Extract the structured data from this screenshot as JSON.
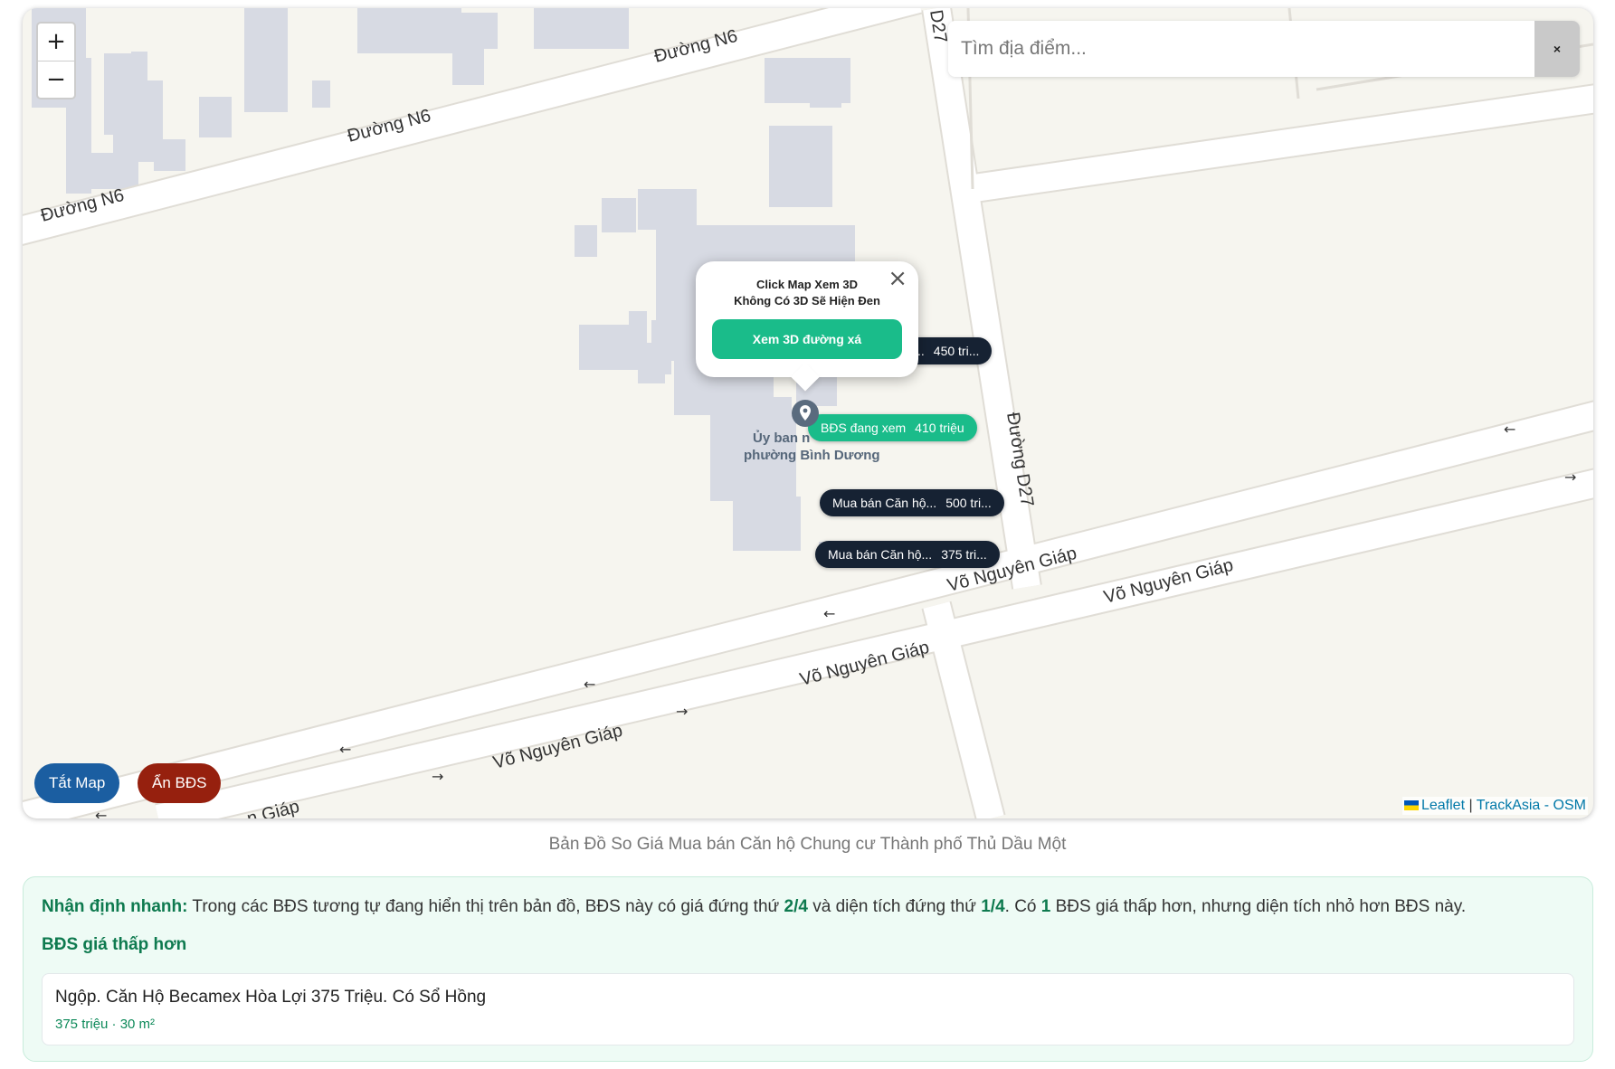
{
  "map": {
    "zoom_in": "+",
    "zoom_out": "−",
    "search": {
      "placeholder": "Tìm địa điểm...",
      "clear": "×"
    },
    "road_labels": {
      "n6_a": "Đường N6",
      "n6_b": "Đường N6",
      "n6_c": "Đường N6",
      "d27_top": "D27",
      "d27_mid": "Đường D27",
      "vng_1": "Võ Nguyên Giáp",
      "vng_2": "Võ Nguyên Giáp",
      "vng_3": "Võ Nguyên Giáp",
      "vng_4": "Võ Nguyên Giáp",
      "vng_5": "n Giáp"
    },
    "poi": {
      "line1": "Ủy ban n",
      "line2": "phường Bình Dương"
    },
    "popup": {
      "line1": "Click Map Xem 3D",
      "line2": "Không Có 3D Sẽ Hiện Đen",
      "button": "Xem 3D đường xá",
      "close": "×"
    },
    "markers": [
      {
        "title": "..",
        "price": "450 tri..."
      },
      {
        "title": "BĐS đang xem",
        "price": "410 triệu"
      },
      {
        "title": "Mua bán Căn hộ...",
        "price": "500 tri..."
      },
      {
        "title": "Mua bán Căn hộ...",
        "price": "375 tri..."
      }
    ],
    "buttons": {
      "off": "Tắt Map",
      "hide": "Ẩn BĐS"
    },
    "attribution": {
      "leaflet": "Leaflet",
      "sep": " | ",
      "provider": "TrackAsia - OSM"
    },
    "colors": {
      "marker": "#162233",
      "marker_active": "#1abc8a",
      "btn_off": "#1b5ea1",
      "btn_hide": "#96200e"
    }
  },
  "caption": "Bản Đồ So Giá Mua bán Căn hộ Chung cư Thành phố Thủ Dầu Một",
  "quick": {
    "label": "Nhận định nhanh:",
    "t1": " Trong các BĐS tương tự đang hiển thị trên bản đồ, BĐS này có giá đứng thứ ",
    "price_rank": "2/4",
    "t2": " và diện tích đứng thứ ",
    "area_rank": "1/4",
    "t3": ". Có ",
    "count": "1",
    "t4": " BĐS giá thấp hơn, nhưng diện tích nhỏ hơn BĐS này."
  },
  "cheaper": {
    "title": "BĐS giá thấp hơn",
    "items": [
      {
        "name": "Ngộp. Căn Hộ Becamex Hòa Lợi 375 Triệu. Có Sổ Hồng",
        "meta": "375 triệu · 30 m²"
      }
    ]
  }
}
